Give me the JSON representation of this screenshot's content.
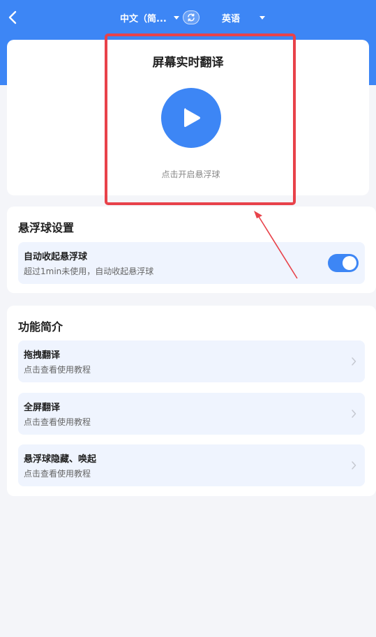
{
  "header": {
    "source_language": "中文（简...",
    "target_language": "英语"
  },
  "hero": {
    "title": "屏幕实时翻译",
    "hint": "点击开启悬浮球"
  },
  "settings": {
    "title": "悬浮球设置",
    "auto_collapse": {
      "label": "自动收起悬浮球",
      "description": "超过1min未使用，自动收起悬浮球",
      "enabled": true
    }
  },
  "intro": {
    "title": "功能简介",
    "items": [
      {
        "title": "拖拽翻译",
        "subtitle": "点击查看使用教程"
      },
      {
        "title": "全屏翻译",
        "subtitle": "点击查看使用教程"
      },
      {
        "title": "悬浮球隐藏、唤起",
        "subtitle": "点击查看使用教程"
      }
    ]
  },
  "colors": {
    "accent": "#3d86f5",
    "annotation": "#e8424a",
    "item_bg": "#eff4fe"
  },
  "icons": {
    "back": "chevron-left-icon",
    "swap": "swap-icon",
    "play": "play-icon",
    "chevron": "chevron-right-icon"
  }
}
